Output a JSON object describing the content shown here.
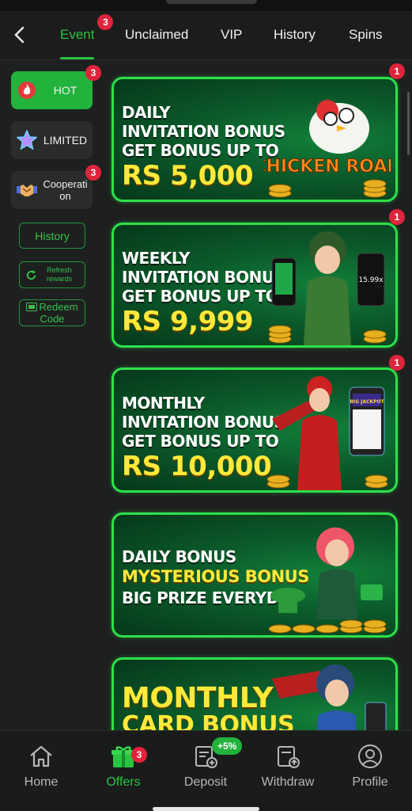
{
  "header": {
    "tabs": [
      {
        "label": "Event",
        "badge": "3",
        "active": true
      },
      {
        "label": "Unclaimed"
      },
      {
        "label": "VIP"
      },
      {
        "label": "History"
      },
      {
        "label": "Spins"
      }
    ]
  },
  "sidebar": {
    "categories": [
      {
        "label": "HOT",
        "badge": "3",
        "icon": "flame-icon",
        "active": true
      },
      {
        "label": "LIMITED",
        "icon": "star-icon"
      },
      {
        "label": "Cooperati\non",
        "badge": "3",
        "icon": "handshake-icon"
      }
    ],
    "buttons": {
      "history": "History",
      "refresh": "Refresh rewards",
      "redeem_prefix": "Redeem",
      "redeem_suffix": "Code"
    }
  },
  "banners": [
    {
      "badge": "1",
      "lines": [
        "DAILY",
        "INVITATION BONUS",
        "GET BONUS UP TO"
      ],
      "amount": "RS 5,000",
      "art": "chicken-road-art",
      "art_text": "CHICKEN ROAD"
    },
    {
      "badge": "1",
      "lines": [
        "WEEKLY",
        "INVITATION BONUS",
        "GET BONUS UP TO"
      ],
      "amount": "RS 9,999",
      "art": "pilot-girl-art",
      "art_text": "15.99x"
    },
    {
      "badge": "1",
      "lines": [
        "MONTHLY",
        "INVITATION BONUS",
        "GET BONUS UP TO"
      ],
      "amount": "RS 10,000",
      "art": "red-pilot-girl-art",
      "art_text": "BIG JACKPOT"
    },
    {
      "lines": [
        "DAILY BONUS",
        "MYSTERIOUS BONUS",
        "BIG PRIZE EVERYDAY"
      ],
      "art": "pink-hair-girl-art"
    },
    {
      "lines": [
        "MONTHLY",
        "CARD BONUS"
      ],
      "art": "aviator-girl-art"
    }
  ],
  "nav": {
    "items": [
      {
        "label": "Home",
        "icon": "home-icon"
      },
      {
        "label": "Offers",
        "icon": "gift-icon",
        "badge": "3",
        "active": true
      },
      {
        "label": "Deposit",
        "icon": "deposit-icon",
        "badge": "+5%"
      },
      {
        "label": "Withdraw",
        "icon": "withdraw-icon"
      },
      {
        "label": "Profile",
        "icon": "profile-icon"
      }
    ]
  },
  "colors": {
    "accent": "#29c43f",
    "badge": "#e0243c",
    "banner_border": "#2ee04b",
    "amount": "#ffe93a"
  }
}
